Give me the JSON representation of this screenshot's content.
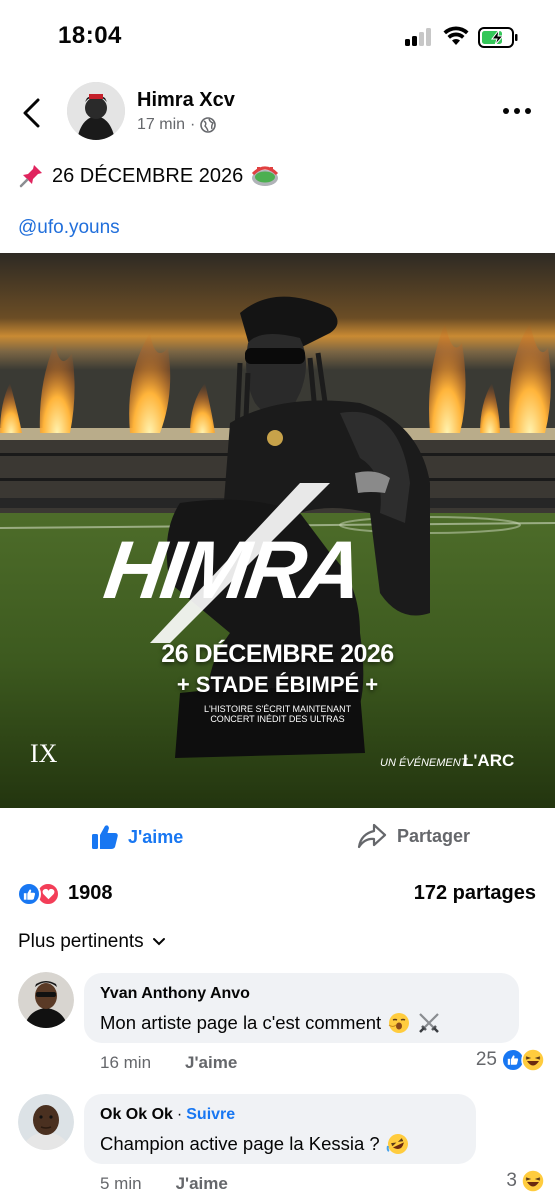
{
  "status_bar": {
    "time": "18:04",
    "battery_color": "#34c759"
  },
  "post": {
    "author": "Himra Xcv",
    "time": "17 min",
    "separator": "·",
    "text": "26 DÉCEMBRE 2026",
    "mention": "@ufo.youns",
    "icons": [
      "pushpin-emoji",
      "stadium-emoji",
      "globe-icon"
    ]
  },
  "poster": {
    "title": "HIMRA",
    "date": "26 DÉCEMBRE 2026",
    "venue": "+ STADE ÉBIMPÉ +",
    "tagline1": "L'HISTOIRE S'ÉCRIT MAINTENANT",
    "tagline2": "CONCERT INÉDIT DES ULTRAS",
    "brand_left": "IX",
    "brand_right_prefix": "UN ÉVÉNEMENT",
    "brand_right": "L'ARC"
  },
  "actions": {
    "like": "J'aime",
    "share": "Partager"
  },
  "stats": {
    "reactions": "1908",
    "shares": "172 partages"
  },
  "sort": {
    "label": "Plus pertinents"
  },
  "comments": [
    {
      "name": "Yvan Anthony Anvo",
      "text": "Mon artiste page la c'est comment",
      "time": "16 min",
      "like": "J'aime",
      "reactions": "25"
    },
    {
      "name": "Ok Ok Ok",
      "separator": "·",
      "follow": "Suivre",
      "text": "Champion active page la Kessia ?",
      "time": "5 min",
      "like": "J'aime",
      "reactions": "3"
    }
  ],
  "colors": {
    "accent": "#1877f2",
    "mention": "#216fdb",
    "meta": "#65676b",
    "bubble": "#f0f2f5",
    "love": "#f33e58"
  }
}
